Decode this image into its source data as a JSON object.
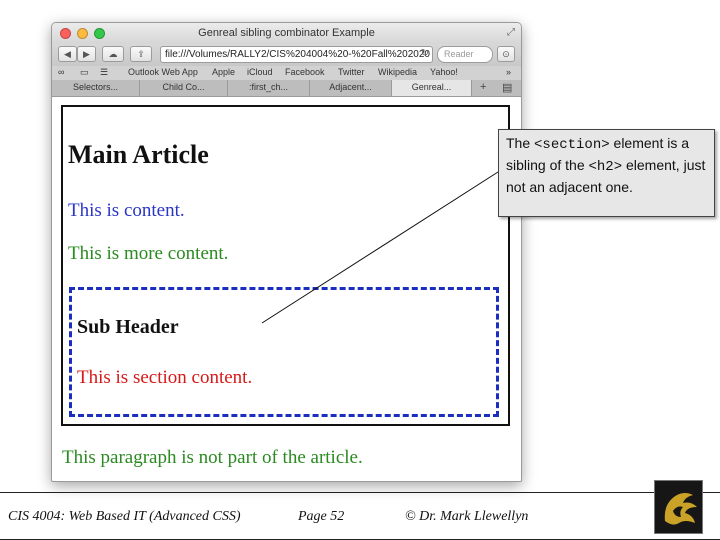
{
  "browser": {
    "title": "Genreal sibling combinator Example",
    "url": "file:///Volumes/RALLY2/CIS%204004%20-%20Fall%202020",
    "search_placeholder": "Reader",
    "bookmarks": [
      "Outlook Web App",
      "Apple",
      "iCloud",
      "Facebook",
      "Twitter",
      "Wikipedia",
      "Yahoo!"
    ],
    "tabs": [
      "Selectors...",
      "Child Co...",
      ":first_ch...",
      "Adjacent...",
      "Genreal..."
    ],
    "colors": {
      "close": "#fc605c",
      "minimize": "#fdbc40",
      "zoom": "#34c84a"
    }
  },
  "page": {
    "heading": "Main Article",
    "p1": "This is content.",
    "p2": "This is more content.",
    "section_heading": "Sub Header",
    "section_text": "This is section content.",
    "outside_text": "This paragraph is not part of the article.",
    "colors": {
      "blue": "#2a36c4",
      "green": "#2a8a20",
      "red": "#d81818",
      "section_border": "#1b2ec0"
    }
  },
  "callout": {
    "t1": "The ",
    "code1": "<section>",
    "t2": " element is a sibling of the ",
    "code2": "<h2>",
    "t3": " element, just not an adjacent one."
  },
  "footer": {
    "course": "CIS 4004: Web Based IT (Advanced CSS)",
    "page": "Page 52",
    "copyright": "© Dr. Mark Llewellyn"
  }
}
